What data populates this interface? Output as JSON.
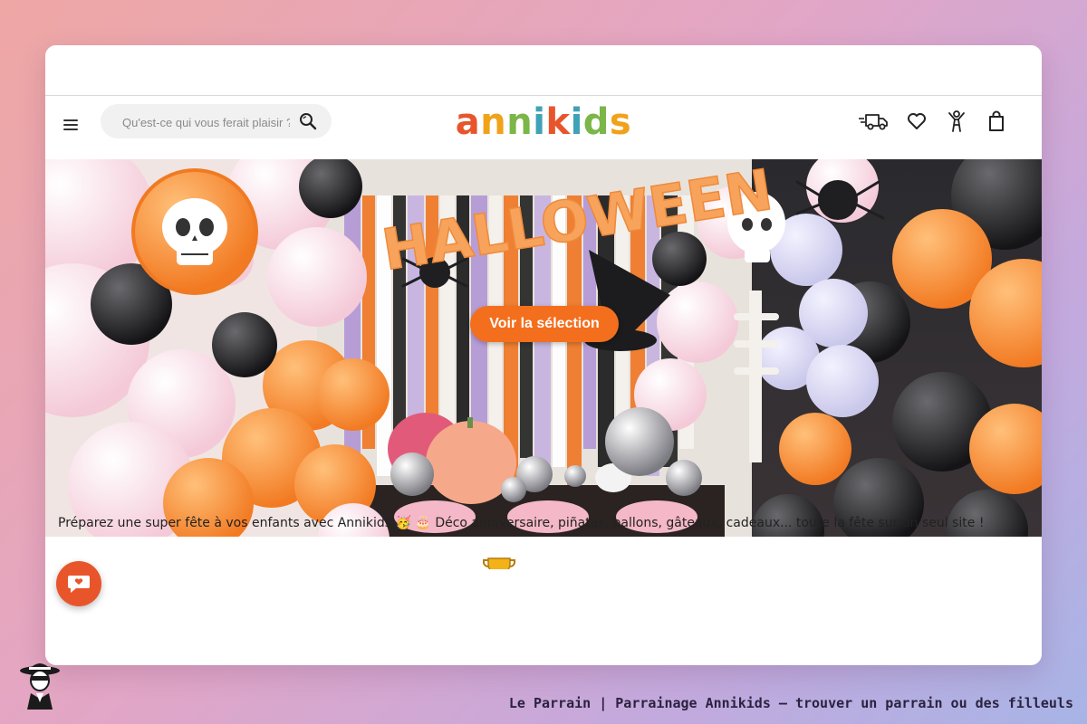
{
  "header": {
    "search_placeholder": "Qu'est-ce qui vous ferait plaisir ?",
    "logo_letters": [
      {
        "ch": "a",
        "color": "#e8552b"
      },
      {
        "ch": "n",
        "color": "#f0a21a"
      },
      {
        "ch": "n",
        "color": "#7ab648"
      },
      {
        "ch": "i",
        "color": "#3fa2b6"
      },
      {
        "ch": "k",
        "color": "#e8552b"
      },
      {
        "ch": "i",
        "color": "#3fa2b6"
      },
      {
        "ch": "d",
        "color": "#7ab648"
      },
      {
        "ch": "s",
        "color": "#f0a21a"
      }
    ],
    "icons": [
      "truck-icon",
      "heart-icon",
      "kid-icon",
      "bag-icon"
    ]
  },
  "hero": {
    "banner_text": "HALLOWEEN",
    "cta_label": "Voir la sélection"
  },
  "tagline": "Préparez une super fête à vos enfants avec Annikids 🥳 🎂 Déco anniversaire, piñatas, ballons, gâteaux, cadeaux... toute la fête sur un seul site !",
  "footer_caption": "Le Parrain | Parrainage Annikids — trouver un parrain ou des filleuls",
  "colors": {
    "accent": "#f36f1e",
    "chat_button": "#e8552b"
  }
}
